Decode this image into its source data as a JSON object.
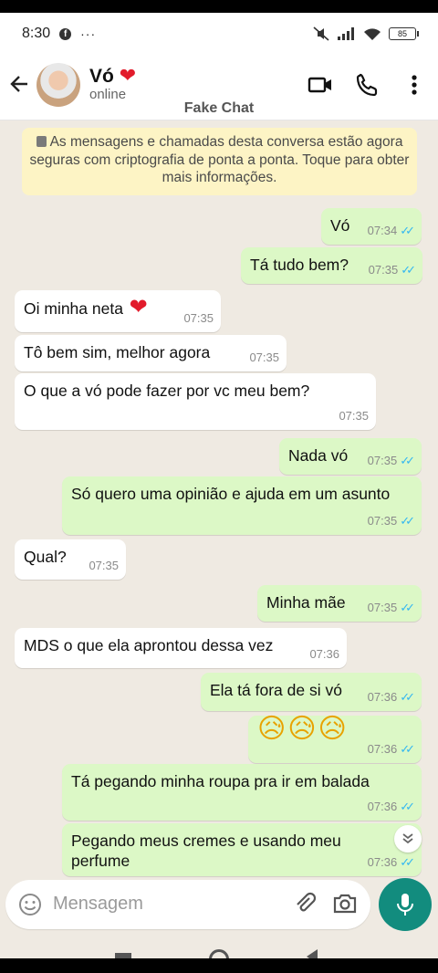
{
  "status_bar": {
    "time": "8:30",
    "fb_badge": "f",
    "more": "···",
    "battery": "85"
  },
  "header": {
    "contact_name": "Vó",
    "contact_heart": "❤",
    "contact_status": "online",
    "watermark": "Fake Chat",
    "icons": [
      "back-arrow-icon",
      "video-call-icon",
      "phone-icon",
      "more-vert-icon"
    ]
  },
  "encryption_notice": "As mensagens e chamadas desta conversa estão agora seguras com criptografia de ponta a ponta. Toque para obter mais informações.",
  "messages": [
    {
      "dir": "out",
      "text": "Vó",
      "time": "07:34"
    },
    {
      "dir": "out",
      "text": "Tá tudo bem?",
      "time": "07:35"
    },
    {
      "dir": "in",
      "text": "Oi minha neta",
      "emoji": "❤",
      "time": "07:35"
    },
    {
      "dir": "in",
      "text": "Tô bem sim, melhor agora",
      "time": "07:35"
    },
    {
      "dir": "in",
      "text": "O que a vó pode fazer por vc meu bem?",
      "time": "07:35"
    },
    {
      "dir": "out",
      "text": "Nada vó",
      "time": "07:35"
    },
    {
      "dir": "out",
      "text": "Só quero uma opinião e ajuda em um asunto",
      "time": "07:35"
    },
    {
      "dir": "in",
      "text": "Qual?",
      "time": "07:35"
    },
    {
      "dir": "out",
      "text": "Minha mãe",
      "time": "07:35"
    },
    {
      "dir": "in",
      "text": "MDS o que ela aprontou dessa vez",
      "time": "07:36"
    },
    {
      "dir": "out",
      "text": "Ela tá fora de si vó",
      "time": "07:36"
    },
    {
      "dir": "out",
      "text": "😥😥😥",
      "time": "07:36"
    },
    {
      "dir": "out",
      "text": "Tá pegando minha roupa pra ir em balada",
      "time": "07:36"
    },
    {
      "dir": "out",
      "text": "Pegando meus cremes e usando meu perfume",
      "time": "07:36"
    }
  ],
  "ticks": "✓✓",
  "composer": {
    "placeholder": "Mensagem"
  },
  "colors": {
    "outgoing": "#dcf8c6",
    "incoming": "#ffffff",
    "chat_bg": "#efeae2",
    "accent": "#128c7e",
    "read_ticks": "#34b7f1"
  }
}
